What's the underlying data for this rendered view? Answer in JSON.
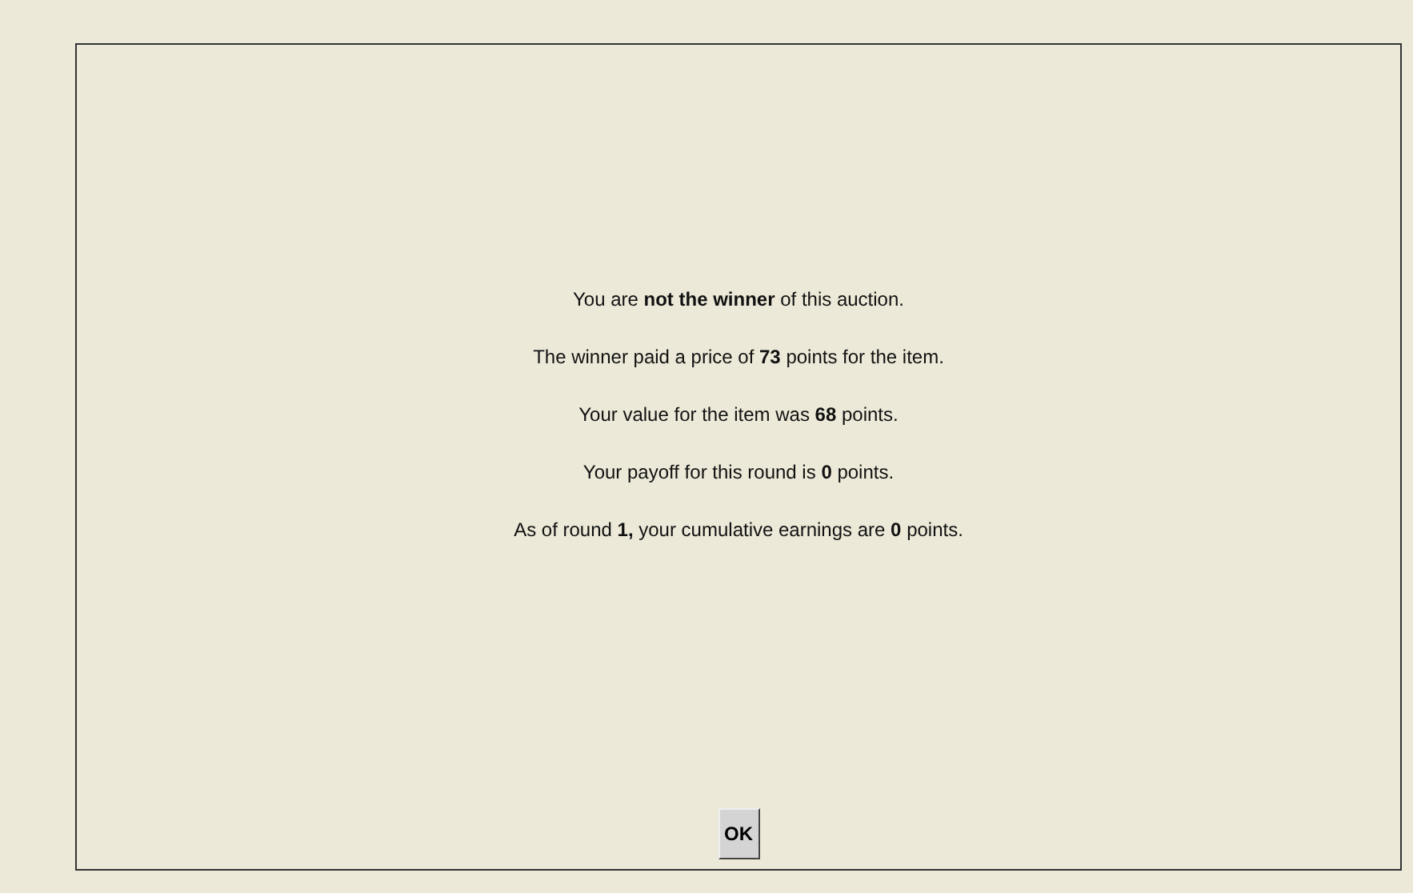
{
  "messages": [
    "You are **not the winner** of this auction.",
    "The winner paid a price of **73** points for the item.",
    "Your value for the item was **68** points.",
    "Your payoff for this round is **0** points.",
    "As of round **1,** your cumulative earnings are **0** points."
  ],
  "button": {
    "label": "OK"
  }
}
